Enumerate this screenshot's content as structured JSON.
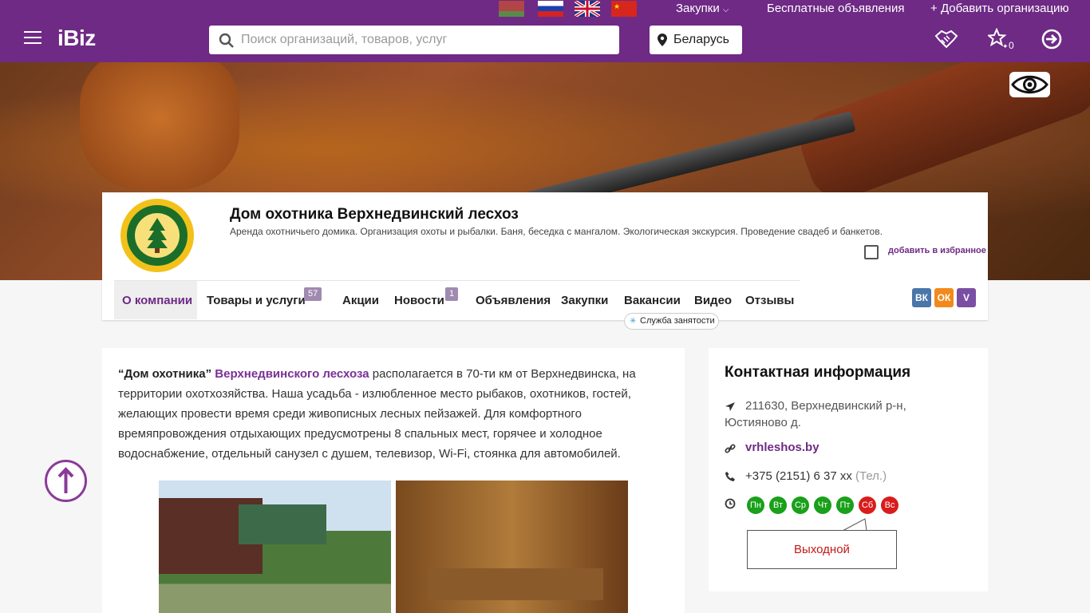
{
  "topbar": {
    "procurements": "Закупки",
    "free_ads": "Бесплатные объявления",
    "add_org": "Добавить организацию",
    "flags": [
      "by-flag",
      "ru-flag",
      "gb-flag",
      "cn-flag"
    ]
  },
  "header": {
    "logo": "iBiz",
    "search_placeholder": "Поиск организаций, товаров, услуг",
    "country": "Беларусь",
    "favorites_count": "0"
  },
  "company": {
    "title": "Дом охотника Верхнедвинский лесхоз",
    "description": "Аренда охотничьего домика. Организация охоты и рыбалки. Баня, беседка с мангалом. Экологическая экскурсия. Проведение свадеб и банкетов.",
    "add_favorite": "добавить в избранное"
  },
  "tabs": [
    {
      "label": "О компании"
    },
    {
      "label": "Товары и услуги",
      "badge": "57"
    },
    {
      "label": "Акции"
    },
    {
      "label": "Новости",
      "badge": "1"
    },
    {
      "label": "Объявления"
    },
    {
      "label": "Закупки"
    },
    {
      "label": "Вакансии"
    },
    {
      "label": "Видео"
    },
    {
      "label": "Отзывы"
    }
  ],
  "employment_pill": "Служба занятости",
  "social": {
    "vk": "ВК",
    "ok": "ОК",
    "viber": "V"
  },
  "about": {
    "quote": "“Дом охотника”",
    "link": "Верхнедвинского лесхоза",
    "text": " располагается в 70-ти км от Верхнедвинска, на территории охотхозяйства. Наша усадьба - излюбленное место рыбаков, охотников, гостей, желающих провести время среди живописных лесных пейзажей. Для комфортного времяпровождения отдыхающих предусмотрены 8 спальных мест, горячее и холодное водоснабжение, отдельный санузел с душем, телевизор, Wi-Fi, стоянка для автомобилей."
  },
  "contact": {
    "heading": "Контактная информация",
    "address": "211630, Верхнедвинский р-н, Юстияново д.",
    "site": "vrhleshos.by",
    "phone": "+375 (2151) 6 37 xx",
    "phone_note": "(Тел.)",
    "days": [
      "Пн",
      "Вт",
      "Ср",
      "Чт",
      "Пт",
      "Сб",
      "Вс"
    ],
    "day_status": [
      "open",
      "open",
      "open",
      "open",
      "open",
      "closed",
      "closed"
    ],
    "day_off": "Выходной"
  },
  "colors": {
    "brand": "#6e2a85",
    "open": "#1aa01a",
    "closed": "#d91c1c"
  }
}
